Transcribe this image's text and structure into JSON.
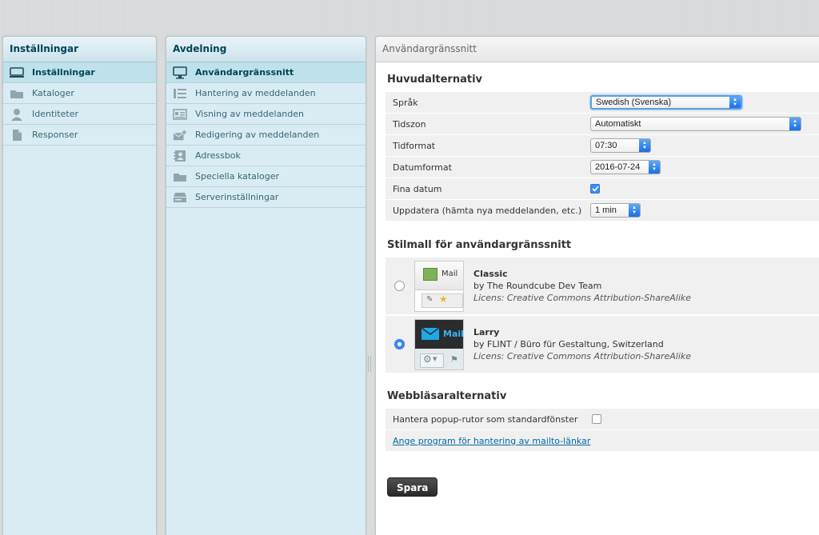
{
  "settings_panel": {
    "header": "Inställningar",
    "items": [
      {
        "label": "Inställningar",
        "icon": "monitor-icon",
        "selected": true
      },
      {
        "label": "Kataloger",
        "icon": "folder-icon"
      },
      {
        "label": "Identiteter",
        "icon": "person-icon"
      },
      {
        "label": "Responser",
        "icon": "document-icon"
      }
    ]
  },
  "section_panel": {
    "header": "Avdelning",
    "items": [
      {
        "label": "Användargränssnitt",
        "icon": "monitor-icon",
        "selected": true
      },
      {
        "label": "Hantering av meddelanden",
        "icon": "list-icon"
      },
      {
        "label": "Visning av meddelanden",
        "icon": "message-view-icon"
      },
      {
        "label": "Redigering av meddelanden",
        "icon": "compose-icon"
      },
      {
        "label": "Adressbok",
        "icon": "address-book-icon"
      },
      {
        "label": "Speciella kataloger",
        "icon": "folder-icon"
      },
      {
        "label": "Serverinställningar",
        "icon": "server-icon"
      }
    ]
  },
  "main": {
    "header": "Användargränssnitt",
    "main_options": {
      "title": "Huvudalternativ",
      "language": {
        "label": "Språk",
        "value": "Swedish (Svenska)"
      },
      "timezone": {
        "label": "Tidszon",
        "value": "Automatiskt"
      },
      "time_format": {
        "label": "Tidformat",
        "value": "07:30"
      },
      "date_format": {
        "label": "Datumformat",
        "value": "2016-07-24"
      },
      "pretty_dates": {
        "label": "Fina datum",
        "checked": true
      },
      "refresh": {
        "label": "Uppdatera (hämta nya meddelanden, etc.)",
        "value": "1 min"
      }
    },
    "skin": {
      "title": "Stilmall för användargränssnitt",
      "skins": [
        {
          "name": "Classic",
          "author": "by The Roundcube Dev Team",
          "license": "Licens: Creative Commons Attribution-ShareAlike",
          "thumb_label": "Mail",
          "selected": false
        },
        {
          "name": "Larry",
          "author": "by FLINT / Büro für Gestaltung, Switzerland",
          "license": "Licens: Creative Commons Attribution-ShareAlike",
          "thumb_label": "Mail",
          "selected": true
        }
      ]
    },
    "browser": {
      "title": "Webbläsaralternativ",
      "popup": {
        "label": "Hantera popup-rutor som standardfönster",
        "checked": false
      },
      "mailto_link": "Ange program för hantering av mailto-länkar"
    },
    "save_label": "Spara"
  },
  "colors": {
    "accent": "#3a8df5",
    "panel_bg": "#d9ecf4",
    "selected_bg": "#bee1eb",
    "header_text": "#004458"
  }
}
